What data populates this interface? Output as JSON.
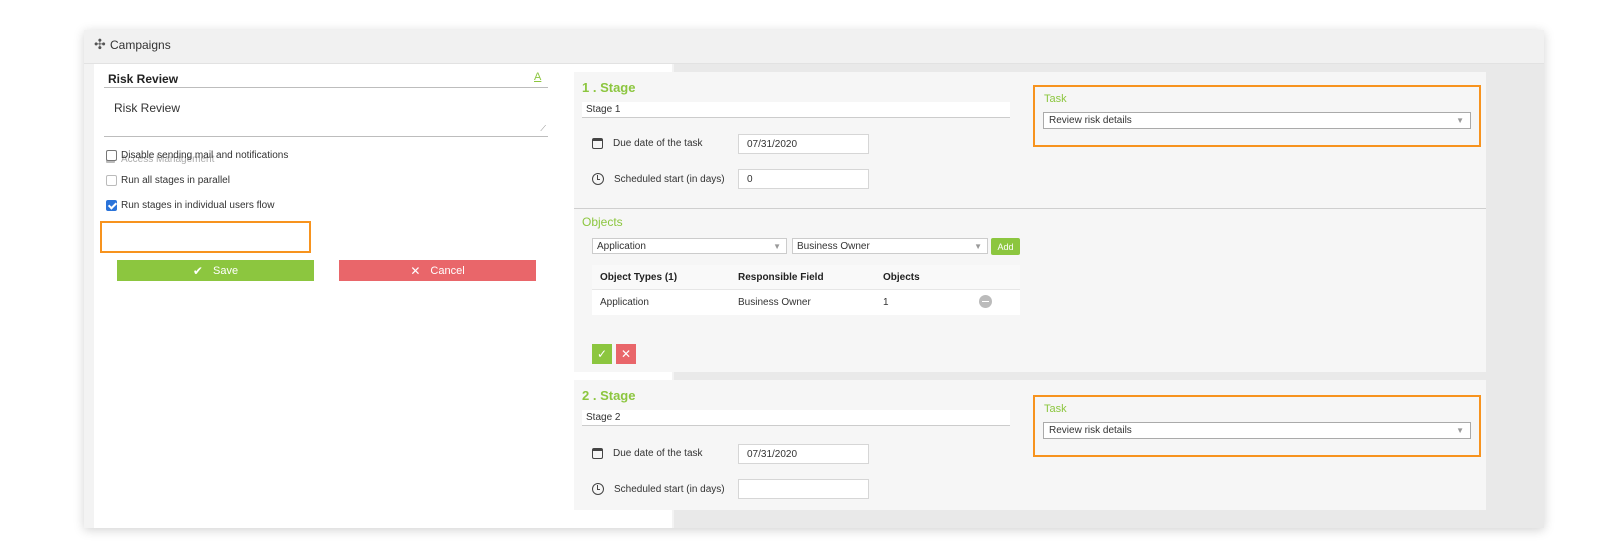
{
  "header": {
    "icon": "gear-icon",
    "title": "Campaigns"
  },
  "campaign": {
    "name": "Risk Review",
    "format_link": "A",
    "description": "Risk Review",
    "access_management": "Access Management",
    "options": [
      {
        "label": "Disable sending mail and notifications",
        "checked": false
      },
      {
        "label": "Run all stages in parallel",
        "checked": false
      },
      {
        "label": "Run stages in individual users flow",
        "checked": true
      }
    ],
    "save_label": "Save",
    "cancel_label": "Cancel"
  },
  "stages": [
    {
      "title": "1 . Stage",
      "name": "Stage 1",
      "due_label": "Due date of the task",
      "due_value": "07/31/2020",
      "start_label": "Scheduled start (in days)",
      "start_value": "0",
      "objects_title": "Objects",
      "object_type_select": "Application",
      "responsible_select": "Business Owner",
      "add_label": "Add",
      "table": {
        "headers": [
          "Object Types (1)",
          "Responsible Field",
          "Objects"
        ],
        "rows": [
          [
            "Application",
            "Business Owner",
            "1"
          ]
        ]
      },
      "task_label": "Task",
      "task_value": "Review risk details"
    },
    {
      "title": "2 . Stage",
      "name": "Stage 2",
      "due_label": "Due date of the task",
      "due_value": "07/31/2020",
      "start_label": "Scheduled start (in days)",
      "start_value": "",
      "task_label": "Task",
      "task_value": "Review risk details"
    }
  ],
  "colors": {
    "accent_green": "#8cc63f",
    "cancel_red": "#e9666a",
    "highlight_orange": "#f7931e"
  }
}
